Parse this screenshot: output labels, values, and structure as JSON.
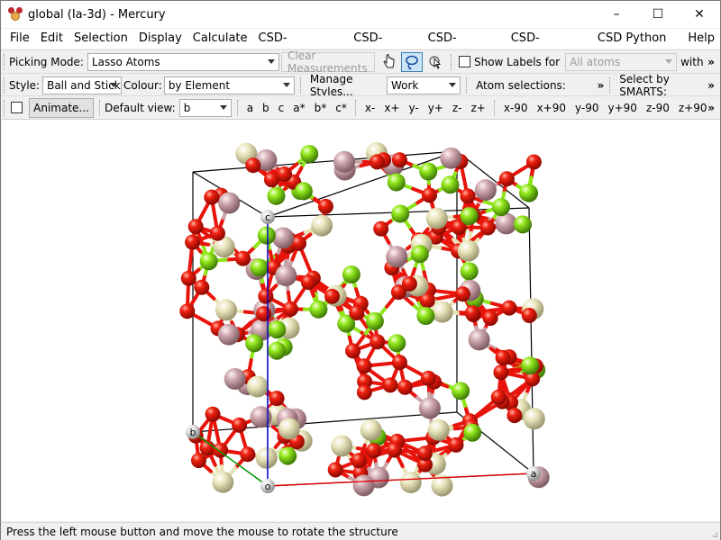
{
  "window": {
    "title": "global (Ia-3d) - Mercury",
    "controls": {
      "minimize": "–",
      "maximize": "☐",
      "close": "✕"
    }
  },
  "menubar": {
    "items": [
      "File",
      "Edit",
      "Selection",
      "Display",
      "Calculate",
      "CSD-Community",
      "CSD-System",
      "CSD-Materials",
      "CSD-Discovery",
      "CSD Python API",
      "Help"
    ]
  },
  "toolbar1": {
    "picking_mode_label": "Picking Mode:",
    "picking_mode_value": "Lasso Atoms",
    "clear_measurements": "Clear Measurements",
    "show_labels_label": "Show Labels for",
    "labels_value": "All atoms",
    "with_label": "with"
  },
  "toolbar2": {
    "style_label": "Style:",
    "style_value": "Ball and Stick",
    "colour_label": "Colour:",
    "colour_value": "by Element",
    "manage_styles": "Manage Styles...",
    "work_value": "Work",
    "atom_selections": "Atom selections:",
    "select_smarts": "Select by SMARTS:"
  },
  "toolbar3": {
    "animate": "Animate...",
    "default_view_label": "Default view:",
    "default_view_value": "b",
    "axis_buttons": [
      "a",
      "b",
      "c",
      "a*",
      "b*",
      "c*"
    ],
    "rotate_buttons": [
      "x-",
      "x+",
      "y-",
      "y+",
      "z-",
      "z+"
    ],
    "rotate90_buttons": [
      "x-90",
      "x+90",
      "y-90",
      "y+90",
      "z-90",
      "z+90"
    ],
    "more": "»"
  },
  "viewer": {
    "axis_labels": {
      "origin": "o",
      "a": "a",
      "b": "b",
      "c": "c"
    },
    "colors": {
      "oxygen": "#e8140c",
      "green_atom": "#8ee51a",
      "pale_atom": "#e6e2b4",
      "pink_atom": "#c9a3a8",
      "cell_edge": "#000000",
      "a_axis": "#e00000",
      "b_axis": "#00a000",
      "c_axis": "#0000d0"
    }
  },
  "statusbar": {
    "message": "Press the left mouse button and move the mouse to rotate the structure"
  }
}
